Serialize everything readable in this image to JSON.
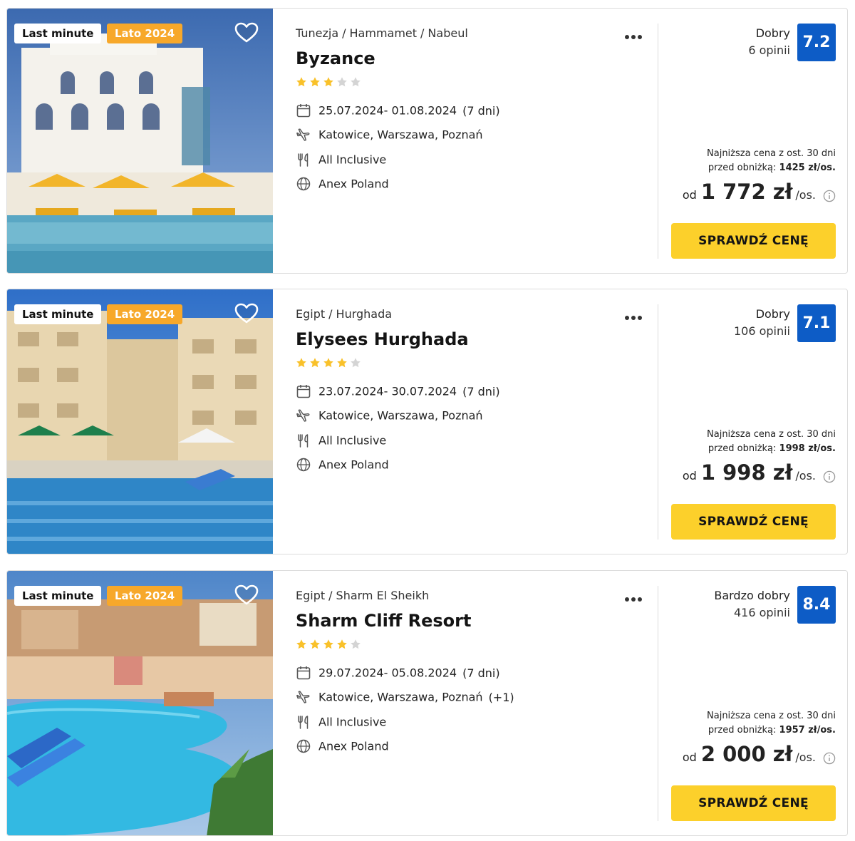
{
  "colors": {
    "accent_yellow": "#fcd02b",
    "season_badge": "#f7a82a",
    "score_blue": "#0d5cc6",
    "star_filled": "#f9c12a",
    "star_empty": "#d4d4d4"
  },
  "offers": [
    {
      "badges": {
        "last_minute": "Last minute",
        "season": "Lato 2024"
      },
      "breadcrumb": [
        "Tunezja",
        "Hammamet",
        "Nabeul"
      ],
      "breadcrumb_sep": "/",
      "title": "Byzance",
      "stars": 3,
      "stars_max": 5,
      "dates": "25.07.2024- 01.08.2024",
      "duration": "(7 dni)",
      "departure": "Katowice, Warszawa, Poznań",
      "departure_extra": "",
      "board": "All Inclusive",
      "operator": "Anex Poland",
      "rating_label": "Dobry",
      "rating_count": "6 opinii",
      "rating_score": "7.2",
      "lowest_line1": "Najniższa cena z ost. 30 dni",
      "lowest_line2_prefix": "przed obniżką:",
      "lowest_value": "1425 zł/os.",
      "price_from": "od",
      "price": "1 772 zł",
      "price_per": "/os.",
      "cta": "SPRAWDŹ CENĘ",
      "photo_scene": "white-arched-hotel-with-pool"
    },
    {
      "badges": {
        "last_minute": "Last minute",
        "season": "Lato 2024"
      },
      "breadcrumb": [
        "Egipt",
        "Hurghada"
      ],
      "breadcrumb_sep": "/",
      "title": "Elysees Hurghada",
      "stars": 4,
      "stars_max": 5,
      "dates": "23.07.2024- 30.07.2024",
      "duration": "(7 dni)",
      "departure": "Katowice, Warszawa, Poznań",
      "departure_extra": "",
      "board": "All Inclusive",
      "operator": "Anex Poland",
      "rating_label": "Dobry",
      "rating_count": "106 opinii",
      "rating_score": "7.1",
      "lowest_line1": "Najniższa cena z ost. 30 dni",
      "lowest_line2_prefix": "przed obniżką:",
      "lowest_value": "1998 zł/os.",
      "price_from": "od",
      "price": "1 998 zł",
      "price_per": "/os.",
      "cta": "SPRAWDŹ CENĘ",
      "photo_scene": "beige-hotel-with-blue-pool"
    },
    {
      "badges": {
        "last_minute": "Last minute",
        "season": "Lato 2024"
      },
      "breadcrumb": [
        "Egipt",
        "Sharm El Sheikh"
      ],
      "breadcrumb_sep": "/",
      "title": "Sharm Cliff Resort",
      "stars": 4,
      "stars_max": 5,
      "dates": "29.07.2024- 05.08.2024",
      "duration": "(7 dni)",
      "departure": "Katowice, Warszawa, Poznań",
      "departure_extra": "(+1)",
      "board": "All Inclusive",
      "operator": "Anex Poland",
      "rating_label": "Bardzo dobry",
      "rating_count": "416 opinii",
      "rating_score": "8.4",
      "lowest_line1": "Najniższa cena z ost. 30 dni",
      "lowest_line2_prefix": "przed obniżką:",
      "lowest_value": "1957 zł/os.",
      "price_from": "od",
      "price": "2 000 zł",
      "price_per": "/os.",
      "cta": "SPRAWDŹ CENĘ",
      "photo_scene": "resort-pool-with-waterslides"
    }
  ]
}
